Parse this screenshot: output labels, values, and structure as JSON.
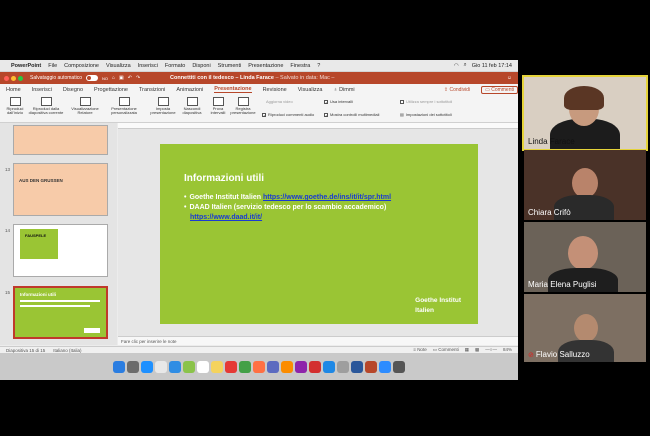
{
  "mac_menu": {
    "app": "PowerPoint",
    "items": [
      "File",
      "Composizione",
      "Visualizza",
      "Inserisci",
      "Formato",
      "Disponi",
      "Strumenti",
      "Presentazione",
      "Finestra",
      "?"
    ],
    "clock": "Gio 11 feb  17:14"
  },
  "title_bar": {
    "autosave": "Salvataggio automatico",
    "toggle": "NO",
    "title": "Connettiti con il tedesco – Linda Farace",
    "saved": "– Salvato in data: Mac –"
  },
  "ribbon_tabs": [
    "Home",
    "Inserisci",
    "Disegno",
    "Progettazione",
    "Transizioni",
    "Animazioni",
    "Presentazione",
    "Revisione",
    "Visualizza"
  ],
  "active_tab": "Presentazione",
  "tell_me": "Dimmi",
  "share_label": "Condividi",
  "comments_label": "Commenti",
  "ribbon_buttons": [
    "Riproduci dall'inizio",
    "Riproduci dalla diapositiva corrente",
    "Visualizzazione Relatore",
    "Presentazione personalizzata",
    "Imposta presentazione",
    "Nascondi diapositiva",
    "Prova intervalli",
    "Registra presentazione"
  ],
  "ribbon_options": {
    "record_video": "Aggiorna video",
    "play_narration": "Riproduci commenti audio",
    "use_timings": "Usa intervalli",
    "show_media": "Mostra controlli multimediali",
    "always_use_subtitles": "Utilizza sempre i sottotitoli",
    "subtitle_settings": "Impostazioni dei sottotitoli"
  },
  "slides_panel": [
    {
      "number": "13",
      "title": "AUS DEN GRUSSEN"
    },
    {
      "number": "14",
      "title": "FAUSPELE"
    },
    {
      "number": "15",
      "title": "Informazioni utili"
    }
  ],
  "slide": {
    "title": "Informazioni utili",
    "bullets": [
      {
        "text": "Goethe Institut Italien ",
        "link": "https://www.goethe.de/ins/it/it/spr.html"
      },
      {
        "text": "DAAD Italien (servizio tedesco per lo scambio accademico)",
        "link": "https://www.daad.it/it/"
      }
    ],
    "brand_line1": "Goethe Institut",
    "brand_line2": "Italien"
  },
  "notes_placeholder": "Fare clic per inserire le note",
  "status_bar": {
    "slide_info": "Diapositiva 15 di 15",
    "language": "Italiano (Italia)",
    "notes": "Note",
    "comments": "Commenti",
    "zoom": "84%"
  },
  "participants": [
    {
      "name": "Linda Farace",
      "active": true,
      "muted": false
    },
    {
      "name": "Chiara Crifò",
      "active": false,
      "muted": false
    },
    {
      "name": "Maria Elena Puglisi",
      "active": false,
      "muted": false
    },
    {
      "name": "Flavio Salluzzo",
      "active": false,
      "muted": true
    }
  ],
  "colors": {
    "ppt_accent": "#b7472a",
    "slide_green": "#9ac534",
    "link_blue": "#1a3bd1",
    "active_speaker": "#e5d33a"
  }
}
